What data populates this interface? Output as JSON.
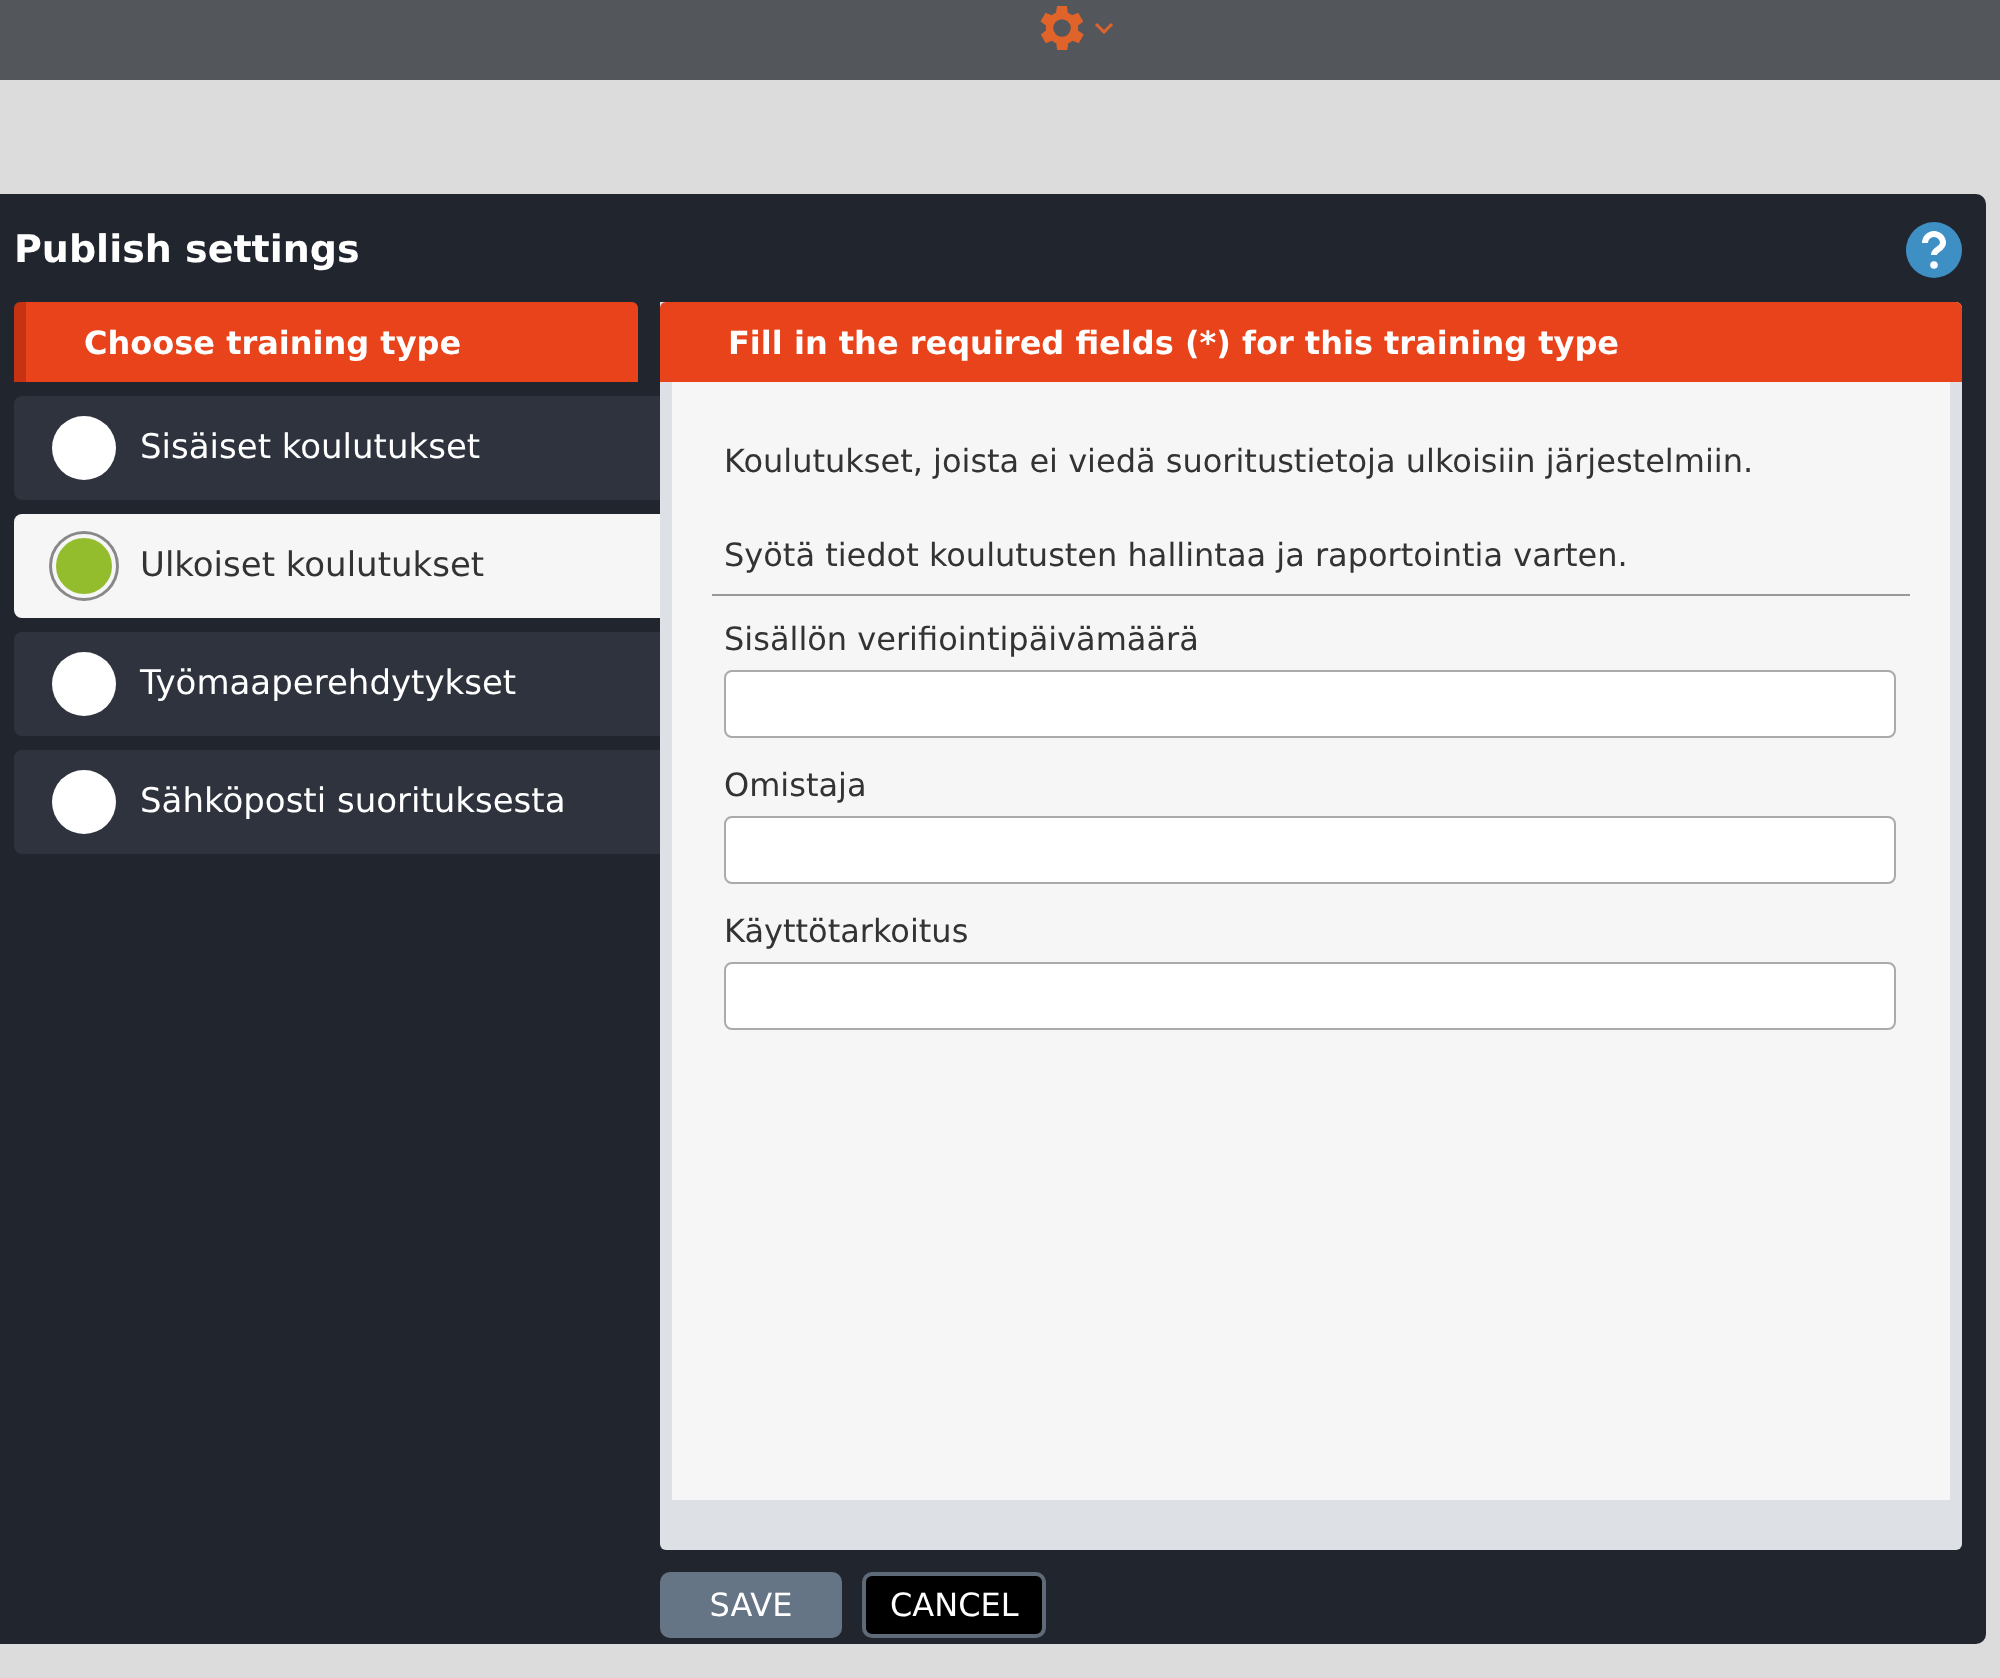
{
  "dialog": {
    "title": "Publish settings"
  },
  "types": {
    "heading": "Choose training type",
    "items": [
      {
        "label": "Sisäiset koulutukset",
        "selected": false
      },
      {
        "label": "Ulkoiset koulutukset",
        "selected": true
      },
      {
        "label": "Työmaaperehdytykset",
        "selected": false
      },
      {
        "label": "Sähköposti suorituksesta",
        "selected": false
      }
    ]
  },
  "details": {
    "heading": "Fill in the required fields (*) for this training type",
    "description": "Koulutukset, joista ei viedä suoritustietoja ulkoisiin järjestelmiin.",
    "instruction": "Syötä tiedot koulutusten hallintaa ja raportointia varten.",
    "fields": [
      {
        "label": "Sisällön verifiointipäivämäärä"
      },
      {
        "label": "Omistaja"
      },
      {
        "label": "Käyttötarkoitus"
      }
    ]
  },
  "buttons": [
    {
      "label": "SAVE",
      "kind": "primary"
    },
    {
      "label": "CANCEL",
      "kind": "secondary"
    }
  ]
}
